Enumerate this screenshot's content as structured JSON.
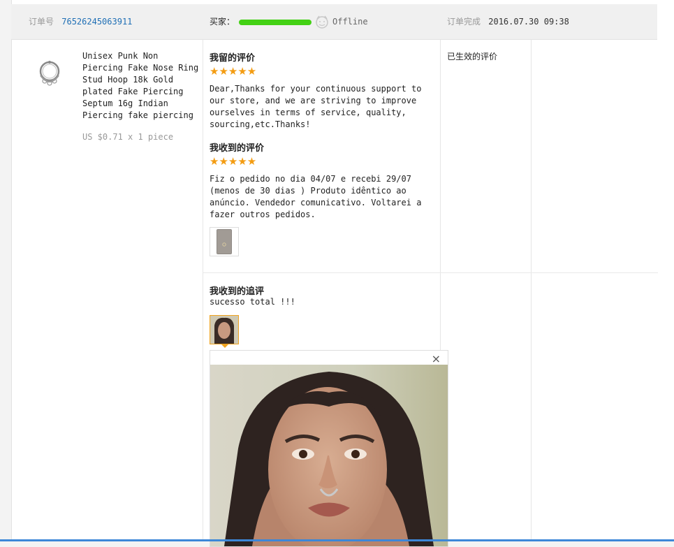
{
  "header": {
    "order_label": "订单号",
    "order_number": "76526245063911",
    "buyer_label": "买家：",
    "buyer_status": "Offline",
    "completed_label": "订单完成",
    "completed_time": "2016.07.30 09:38"
  },
  "product": {
    "name_lines": [
      "Unisex Punk Non",
      "Piercing Fake Nose Ring",
      "Stud Hoop 18k Gold",
      "plated Fake Piercing",
      "Septum 16g Indian",
      "Piercing fake piercing"
    ],
    "price": "US $0.71 x 1 piece"
  },
  "my_review": {
    "title": "我留的评价",
    "stars": "★★★★★",
    "lines": [
      "Dear,Thanks for your continuous support to",
      "our store, and we are striving to improve",
      "ourselves in terms of service, quality,",
      "sourcing,etc.Thanks!"
    ]
  },
  "received_review": {
    "title": "我收到的评价",
    "stars": "★★★★★",
    "lines": [
      "Fiz o pedido no dia 04/07 e recebi 29/07",
      "(menos de 30 dias ) Produto idêntico ao",
      "anúncio. Vendedor comunicativo. Voltarei a",
      "fazer outros pedidos."
    ]
  },
  "effective": {
    "label": "已生效的评价"
  },
  "followup": {
    "title": "我收到的追评",
    "text": "sucesso total !!!",
    "close_symbol": "×"
  },
  "colors": {
    "accent_blue": "#1f6fb5",
    "star_orange": "#f39c12",
    "thumb_border_active": "#f0a31f",
    "bottom_bar": "#3c87d8"
  }
}
